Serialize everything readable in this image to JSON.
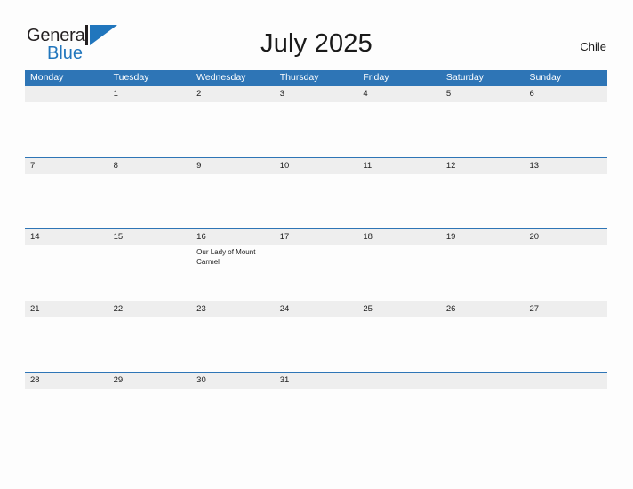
{
  "brand": {
    "name_part1": "General",
    "name_part2": "Blue",
    "mark_icon": "triangle-flag-icon",
    "accent_color": "#2176bd"
  },
  "header": {
    "title": "July 2025",
    "region": "Chile"
  },
  "theme": {
    "header_blue": "#2e75b6",
    "row_band_grey": "#eeeeee",
    "page_background": "#fdfdfd",
    "text_color": "#222222"
  },
  "calendar": {
    "weekdays": [
      "Monday",
      "Tuesday",
      "Wednesday",
      "Thursday",
      "Friday",
      "Saturday",
      "Sunday"
    ],
    "weeks": [
      {
        "days": [
          {
            "date": "",
            "event": ""
          },
          {
            "date": "1",
            "event": ""
          },
          {
            "date": "2",
            "event": ""
          },
          {
            "date": "3",
            "event": ""
          },
          {
            "date": "4",
            "event": ""
          },
          {
            "date": "5",
            "event": ""
          },
          {
            "date": "6",
            "event": ""
          }
        ]
      },
      {
        "days": [
          {
            "date": "7",
            "event": ""
          },
          {
            "date": "8",
            "event": ""
          },
          {
            "date": "9",
            "event": ""
          },
          {
            "date": "10",
            "event": ""
          },
          {
            "date": "11",
            "event": ""
          },
          {
            "date": "12",
            "event": ""
          },
          {
            "date": "13",
            "event": ""
          }
        ]
      },
      {
        "days": [
          {
            "date": "14",
            "event": ""
          },
          {
            "date": "15",
            "event": ""
          },
          {
            "date": "16",
            "event": "Our Lady of Mount Carmel"
          },
          {
            "date": "17",
            "event": ""
          },
          {
            "date": "18",
            "event": ""
          },
          {
            "date": "19",
            "event": ""
          },
          {
            "date": "20",
            "event": ""
          }
        ]
      },
      {
        "days": [
          {
            "date": "21",
            "event": ""
          },
          {
            "date": "22",
            "event": ""
          },
          {
            "date": "23",
            "event": ""
          },
          {
            "date": "24",
            "event": ""
          },
          {
            "date": "25",
            "event": ""
          },
          {
            "date": "26",
            "event": ""
          },
          {
            "date": "27",
            "event": ""
          }
        ]
      },
      {
        "days": [
          {
            "date": "28",
            "event": ""
          },
          {
            "date": "29",
            "event": ""
          },
          {
            "date": "30",
            "event": ""
          },
          {
            "date": "31",
            "event": ""
          },
          {
            "date": "",
            "event": ""
          },
          {
            "date": "",
            "event": ""
          },
          {
            "date": "",
            "event": ""
          }
        ]
      }
    ]
  }
}
